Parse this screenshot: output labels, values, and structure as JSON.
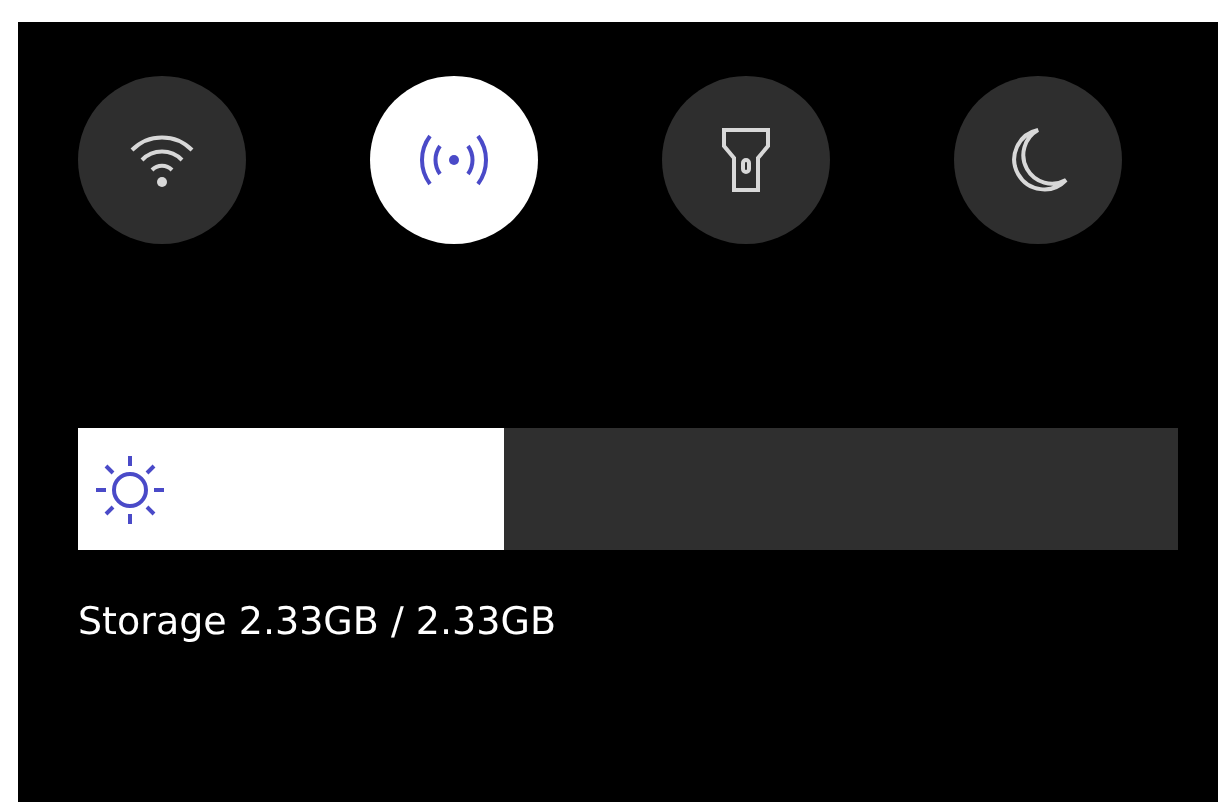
{
  "toggles": [
    {
      "kind": "wifi",
      "on": false
    },
    {
      "kind": "hotspot",
      "on": true
    },
    {
      "kind": "flashlight",
      "on": false
    },
    {
      "kind": "moon",
      "on": false
    }
  ],
  "brightness": {
    "level": 0.387
  },
  "storage": "Storage 2.33GB / 2.33GB"
}
